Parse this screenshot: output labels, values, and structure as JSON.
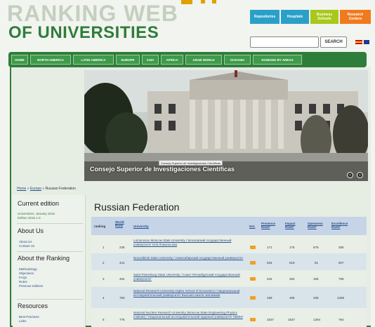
{
  "header": {
    "logo_line1": "RANKING WEB",
    "logo_line2": "OF UNIVERSITIES",
    "top_buttons": [
      {
        "label": "Repositories",
        "color": "#2aa0c8"
      },
      {
        "label": "Hospitals",
        "color": "#2aa0c8"
      },
      {
        "label": "Business Schools",
        "color": "#a8c81a"
      },
      {
        "label": "Research Centers",
        "color": "#f07a1e"
      }
    ],
    "search_placeholder": "",
    "search_button": "SEARCH"
  },
  "nav": {
    "items": [
      "HOME",
      "NORTH AMERICA",
      "LATIN AMERICA",
      "EUROPE",
      "ASIA",
      "AFRICA",
      "ARAB WORLD",
      "OCEANIA",
      "RANKING BY AREAS"
    ]
  },
  "hero": {
    "caption": "Consejo Superior de Investigaciones Científicas",
    "tooltip": "Consejo Superior de Investigaciones Científicas",
    "prev": "‹",
    "next": "›"
  },
  "breadcrumb": {
    "home": "Home",
    "sep1": " » ",
    "europe": "Europe",
    "sep2": " » ",
    "current": "Russian Federation"
  },
  "sidebar": {
    "current_edition": "Current edition",
    "edition_line1": "Universities: January 2016",
    "edition_line2": "Edition 2016.1.0",
    "about_us": "About Us",
    "about_us_links": [
      "About Us",
      "Contact Us"
    ],
    "about_ranking": "About the Ranking",
    "about_ranking_links": [
      "Methodology",
      "Objectives",
      "FAQs",
      "Notes",
      "Previous editions"
    ],
    "resources": "Resources",
    "resources_links": [
      "Best Practices",
      "Links"
    ]
  },
  "main": {
    "title": "Russian Federation",
    "columns": [
      "ranking",
      "World Rank",
      "University",
      "Det.",
      "Presence Rank*",
      "Impact Rank*",
      "Openness Rank*",
      "Excellence Rank*"
    ],
    "rows": [
      {
        "ranking": "1",
        "world": "235",
        "university": "Lomonosov Moscow State University / Московский государственный университет М.В.Ломоносова",
        "presence": "171",
        "impact": "176",
        "openness": "679",
        "excellence": "306"
      },
      {
        "ranking": "2",
        "world": "441",
        "university": "Novosibirsk State University / Новосибирский государственный университет",
        "presence": "934",
        "impact": "619",
        "openness": "81",
        "excellence": "607"
      },
      {
        "ranking": "3",
        "world": "454",
        "university": "Saint Petersburg State University / Санкт-Петербургский государственный университет",
        "presence": "342",
        "impact": "462",
        "openness": "165",
        "excellence": "759"
      },
      {
        "ranking": "4",
        "world": "700",
        "university": "National Research University Higher School of Economics / Национальный исследовательский университет Высшая школа экономики",
        "presence": "199",
        "impact": "495",
        "openness": "339",
        "excellence": "1269"
      },
      {
        "ranking": "5",
        "world": "776",
        "university": "National Nuclear Research University (Moscow State Engineering Physics Institute) / Национальный исследовательский ядерный университет МИФИ",
        "presence": "1537",
        "impact": "1637",
        "openness": "1294",
        "excellence": "764"
      }
    ]
  }
}
